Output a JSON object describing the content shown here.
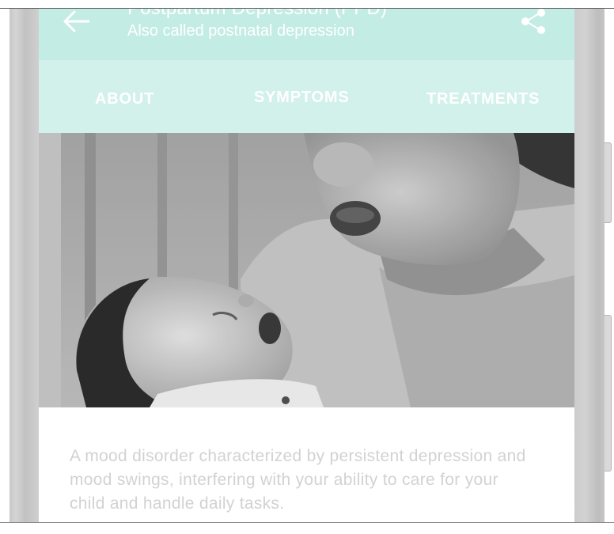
{
  "header": {
    "title": "Postpartum Depression (PPD)",
    "subtitle": "Also called postnatal depression",
    "back_icon": "arrow-left-icon",
    "share_icon": "share-icon"
  },
  "tabs": [
    {
      "label": "ABOUT",
      "selected": true
    },
    {
      "label": "SYMPTOMS",
      "selected": false
    },
    {
      "label": "TREATMENTS",
      "selected": false
    }
  ],
  "article": {
    "description": "A mood disorder characterized by persistent depression and mood swings, interfering with your ability to care for your child and handle daily tasks."
  },
  "colors": {
    "appbar": "#c3ece4",
    "tabbar": "#d2f1eb",
    "indicator": "#ffffff",
    "body_text": "#d2d2d2"
  }
}
